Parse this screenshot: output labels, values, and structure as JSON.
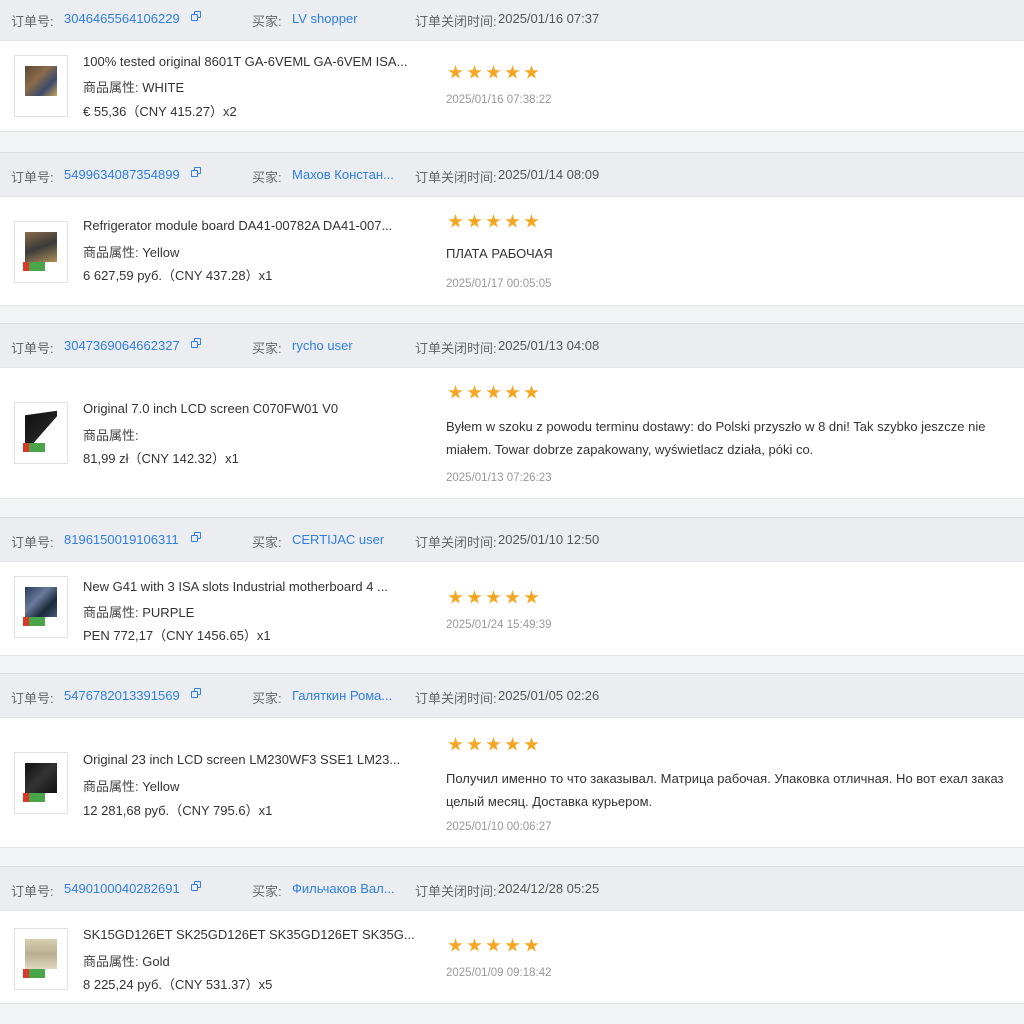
{
  "labels": {
    "order_no": "订单号:",
    "buyer": "买家:",
    "close_time": "订单关闭时间:",
    "attr": "商品属性:"
  },
  "orders": [
    {
      "order_id": "3046465564106229",
      "buyer": "LV shopper",
      "close_time": "2025/01/16 07:37",
      "product_title": "100% tested original 8601T GA-6VEML GA-6VEM ISA...",
      "attr_value": "WHITE",
      "price": "€ 55,36（CNY  415.27）x2",
      "stars": 5,
      "review": "",
      "review_date": "2025/01/16 07:38:22"
    },
    {
      "order_id": "5499634087354899",
      "buyer": "Махов Констан...",
      "close_time": "2025/01/14 08:09",
      "product_title": "Refrigerator module board DA41-00782A DA41-007...",
      "attr_value": "Yellow",
      "price": "6 627,59 руб.（CNY  437.28）x1",
      "stars": 5,
      "review": "ПЛАТА РАБОЧАЯ",
      "review_date": "2025/01/17 00:05:05"
    },
    {
      "order_id": "3047369064662327",
      "buyer": "rycho user",
      "close_time": "2025/01/13 04:08",
      "product_title": "Original 7.0 inch LCD screen C070FW01 V0",
      "attr_value": "",
      "price": "81,99 zł（CNY  142.32）x1",
      "stars": 5,
      "review": "Byłem w szoku z powodu terminu dostawy: do Polski przyszło w 8 dni! Tak szybko jeszcze nie miałem. Towar dobrze zapakowany, wyświetlacz działa, póki co.",
      "review_date": "2025/01/13 07:26:23"
    },
    {
      "order_id": "8196150019106311",
      "buyer": "CERTIJAC user",
      "close_time": "2025/01/10 12:50",
      "product_title": "New G41 with 3 ISA slots Industrial motherboard 4 ...",
      "attr_value": "PURPLE",
      "price": "PEN 772,17（CNY  1456.65）x1",
      "stars": 5,
      "review": "",
      "review_date": "2025/01/24 15:49:39"
    },
    {
      "order_id": "5476782013391569",
      "buyer": "Галяткин Рома...",
      "close_time": "2025/01/05 02:26",
      "product_title": "Original 23 inch LCD screen LM230WF3 SSE1 LM23...",
      "attr_value": "Yellow",
      "price": "12 281,68 руб.（CNY  795.6）x1",
      "stars": 5,
      "review": "Получил именно то что заказывал. Матрица рабочая. Упаковка отличная. Но вот ехал заказ целый месяц. Доставка курьером.",
      "review_date": "2025/01/10 00:06:27"
    },
    {
      "order_id": "5490100040282691",
      "buyer": "Фильчаков Вал...",
      "close_time": "2024/12/28 05:25",
      "product_title": "SK15GD126ET SK25GD126ET SK35GD126ET SK35G...",
      "attr_value": "Gold",
      "price": "8 225,24 руб.（CNY  531.37）x5",
      "stars": 5,
      "review": "",
      "review_date": "2025/01/09 09:18:42"
    }
  ]
}
